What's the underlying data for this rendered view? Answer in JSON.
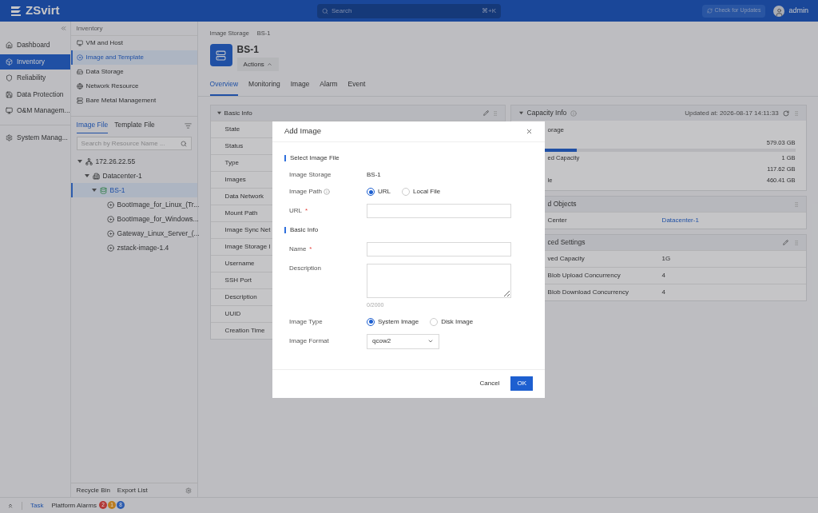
{
  "header": {
    "logo": "ZSvirt",
    "search_placeholder": "Search",
    "shortcut": "⌘+K",
    "update_button": "Check for Updates",
    "user": "admin"
  },
  "nav": [
    {
      "label": "Dashboard",
      "selected": false
    },
    {
      "label": "Inventory",
      "selected": true
    },
    {
      "label": "Reliability",
      "selected": false
    },
    {
      "label": "Data Protection",
      "selected": false
    },
    {
      "label": "O&M Managem...",
      "selected": false
    },
    {
      "label": "System Manag...",
      "selected": false
    }
  ],
  "subnav": {
    "title": "Inventory",
    "items": [
      {
        "label": "VM and Host",
        "selected": false
      },
      {
        "label": "Image and Template",
        "selected": true
      },
      {
        "label": "Data Storage",
        "selected": false
      },
      {
        "label": "Network Resource",
        "selected": false
      },
      {
        "label": "Bare Metal Management",
        "selected": false
      }
    ]
  },
  "resource_tabs": [
    {
      "label": "Image File",
      "selected": true
    },
    {
      "label": "Template File",
      "selected": false
    }
  ],
  "resource_search": {
    "placeholder": "Search by Resource Name ..."
  },
  "tree": [
    {
      "label": "172.26.22.55",
      "expanded": true,
      "selected": false,
      "children": [
        {
          "label": "Datacenter-1",
          "expanded": true,
          "selected": false,
          "children": [
            {
              "label": "BS-1",
              "expanded": true,
              "selected": true,
              "children": [
                {
                  "label": "BootImage_for_Linux_(Tr...",
                  "selected": false
                },
                {
                  "label": "BootImage_for_Windows...",
                  "selected": false
                },
                {
                  "label": "Gateway_Linux_Server_(...",
                  "selected": false
                },
                {
                  "label": "zstack-image-1.4",
                  "selected": false
                }
              ]
            }
          ]
        }
      ]
    }
  ],
  "panel_footer": [
    "Recycle Bin",
    "Export List"
  ],
  "breadcrumb": [
    "Image Storage",
    "BS-1"
  ],
  "title": "BS-1",
  "actions_button": "Actions",
  "detail_tabs": [
    {
      "label": "Overview",
      "selected": true
    },
    {
      "label": "Monitoring",
      "selected": false
    },
    {
      "label": "Image",
      "selected": false
    },
    {
      "label": "Alarm",
      "selected": false
    },
    {
      "label": "Event",
      "selected": false
    }
  ],
  "basic_info": {
    "title": "Basic Info",
    "rows": [
      "State",
      "Status",
      "Type",
      "Images",
      "Data Network",
      "Mount Path",
      "Image Sync Net",
      "Image Storage I",
      "Username",
      "SSH Port",
      "Description",
      "UUID",
      "Creation Time"
    ]
  },
  "capacity": {
    "title": "Capacity Info",
    "updated": "Updated at: 2026-08-17 14:11:33",
    "storage_label": "orage",
    "total": "579.03 GB",
    "level": 0.2,
    "rows": [
      {
        "label": "ed Capacity",
        "value": "1 GB"
      },
      {
        "value": "117.62 GB"
      },
      {
        "label": "le",
        "value": "460.41 GB"
      }
    ]
  },
  "related": {
    "title": "d Objects",
    "rows": [
      {
        "label": "Center",
        "value": "Datacenter-1"
      }
    ]
  },
  "advanced": {
    "title": "ced Settings",
    "rows": [
      {
        "label": "ved Capacity",
        "value": "1G"
      },
      {
        "label": "Blob Upload Concurrency",
        "value": "4"
      },
      {
        "label": "Blob Download Concurrency",
        "value": "4"
      }
    ]
  },
  "status_bar": {
    "task": "Task",
    "alarms_label": "Platform Alarms",
    "alarm_counts": [
      {
        "count": "2",
        "color": "#b23937"
      },
      {
        "count": "1",
        "color": "#b97c21"
      },
      {
        "count": "8",
        "color": "#2d5cae"
      }
    ]
  },
  "dialog": {
    "title": "Add Image",
    "sections": [
      {
        "title": "Select Image File",
        "fields": [
          {
            "kind": "text",
            "label": "Image Storage",
            "value": "BS-1"
          },
          {
            "kind": "radio",
            "label": "Image Path",
            "info": true,
            "options": [
              {
                "label": "URL",
                "selected": true
              },
              {
                "label": "Local File",
                "selected": false
              }
            ]
          },
          {
            "kind": "input",
            "label": "URL",
            "required_mark": "*"
          }
        ]
      },
      {
        "title": "Basic Info",
        "fields": [
          {
            "kind": "input",
            "label": "Name",
            "required_mark": "*"
          },
          {
            "kind": "textarea",
            "label": "Description",
            "counter": "0/2000"
          },
          {
            "kind": "radio",
            "label": "Image Type",
            "options": [
              {
                "label": "System Image",
                "selected": true
              },
              {
                "label": "Disk Image",
                "selected": false
              }
            ]
          },
          {
            "kind": "select",
            "label": "Image Format",
            "value": "qcow2"
          }
        ]
      }
    ],
    "cancel": "Cancel",
    "ok": "OK"
  }
}
